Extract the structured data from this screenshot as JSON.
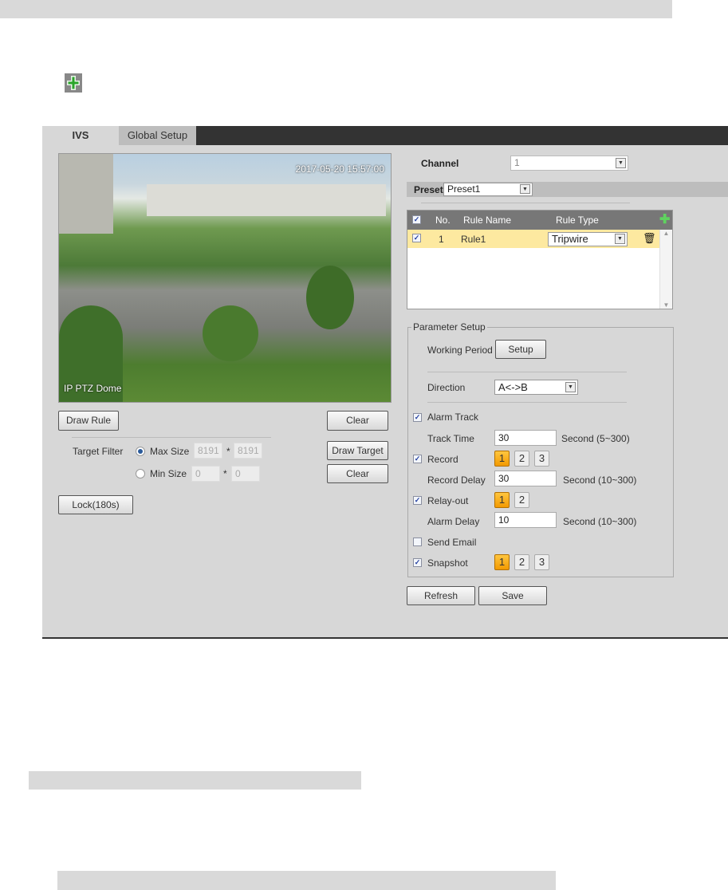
{
  "tabs": [
    {
      "label": "IVS",
      "active": true
    },
    {
      "label": "Global Setup",
      "active": false
    }
  ],
  "video": {
    "timestamp": "2017-05-20 15:57:00",
    "camera_name": "IP PTZ Dome"
  },
  "left": {
    "draw_rule": "Draw Rule",
    "clear": "Clear",
    "target_filter": "Target Filter",
    "max_size": "Max Size",
    "max_w": "8191",
    "max_h": "8191",
    "min_size": "Min Size",
    "min_w": "0",
    "min_h": "0",
    "times": "*",
    "draw_target": "Draw Target",
    "clear2": "Clear",
    "lock": "Lock(180s)"
  },
  "channel": {
    "label": "Channel",
    "value": "1"
  },
  "preset": {
    "label": "Preset",
    "value": "Preset1"
  },
  "rules": {
    "headers": {
      "no": "No.",
      "name": "Rule Name",
      "type": "Rule Type"
    },
    "rows": [
      {
        "no": "1",
        "name": "Rule1",
        "type": "Tripwire",
        "checked": true
      }
    ]
  },
  "params": {
    "legend": "Parameter Setup",
    "working_period": "Working Period",
    "setup": "Setup",
    "direction": "Direction",
    "direction_value": "A<->B",
    "alarm_track": "Alarm Track",
    "track_time": "Track Time",
    "track_time_value": "30",
    "track_time_hint": "Second (5~300)",
    "record": "Record",
    "record_delay": "Record Delay",
    "record_delay_value": "30",
    "record_delay_hint": "Second (10~300)",
    "relay_out": "Relay-out",
    "alarm_delay": "Alarm Delay",
    "alarm_delay_value": "10",
    "alarm_delay_hint": "Second (10~300)",
    "send_email": "Send Email",
    "snapshot": "Snapshot",
    "n1": "1",
    "n2": "2",
    "n3": "3"
  },
  "footer": {
    "refresh": "Refresh",
    "save": "Save"
  },
  "colors": {
    "accent": "#f39a00",
    "row_highlight": "#fde9a0",
    "tabstrip": "#333333"
  }
}
